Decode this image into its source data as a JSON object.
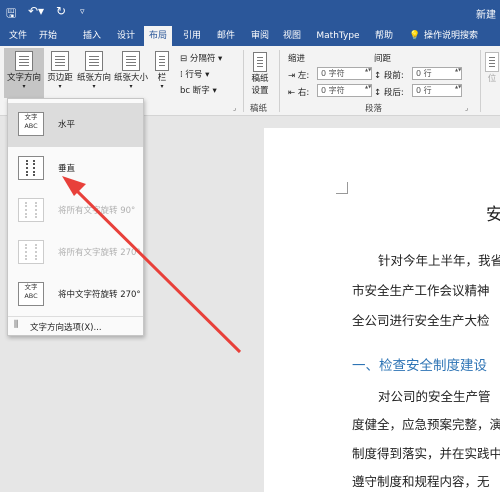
{
  "titlebar": {
    "doc_title": "新建"
  },
  "tabs": [
    "文件",
    "开始",
    "插入",
    "设计",
    "布局",
    "引用",
    "邮件",
    "审阅",
    "视图",
    "MathType",
    "帮助",
    "操作说明搜索"
  ],
  "active_tab": "布局",
  "ribbon": {
    "text_direction": "文字方向",
    "margins": "页边距",
    "orientation": "纸张方向",
    "size": "纸张大小",
    "columns": "栏",
    "breaks": "分隔符",
    "line_numbers": "行号",
    "hyphenation": "断字",
    "draft_settings_line1": "稿纸",
    "draft_settings_line2": "设置",
    "draft_group": "稿纸",
    "indent_title": "缩进",
    "spacing_title": "间距",
    "indent_left_label": "左:",
    "indent_left_value": "0 字符",
    "indent_right_label": "右:",
    "indent_right_value": "0 字符",
    "spacing_before_label": "段前:",
    "spacing_before_value": "0 行",
    "spacing_after_label": "段后:",
    "spacing_after_value": "0 行",
    "paragraph_group": "段落",
    "position_label": "位"
  },
  "menu": {
    "items": [
      {
        "label": "水平",
        "icon_text": "文字 ABC",
        "icon": "text-horizontal-icon",
        "state": "selected"
      },
      {
        "label": "垂直",
        "icon_text": "",
        "icon": "text-vertical-icon",
        "state": "normal"
      },
      {
        "label": "将所有文字旋转 90°",
        "icon_text": "",
        "icon": "rotate-90-icon",
        "state": "disabled"
      },
      {
        "label": "将所有文字旋转 270°",
        "icon_text": "",
        "icon": "rotate-270-icon",
        "state": "disabled"
      },
      {
        "label": "将中文字符旋转 270°",
        "icon_text": "文字 ABC",
        "icon": "rotate-cjk-270-icon",
        "state": "normal"
      }
    ],
    "footer": "文字方向选项(X)..."
  },
  "document": {
    "title_fragment": "安",
    "para1_line1": "针对今年上半年，我省",
    "para1_line2": "市安全生产工作会议精神",
    "para1_line3": "全公司进行安全生产大检",
    "heading1": "一、检查安全制度建设",
    "para2_line1": "对公司的安全生产管",
    "para2_line2": "度健全，应急预案完整，演",
    "para2_line3": "制度得到落实，并在实践中",
    "para2_line4": "遵守制度和规程内容，无"
  },
  "colors": {
    "title_bar": "#2b579a",
    "accent": "#2b579a",
    "heading": "#2e74b5",
    "arrow": "#e8403a"
  }
}
